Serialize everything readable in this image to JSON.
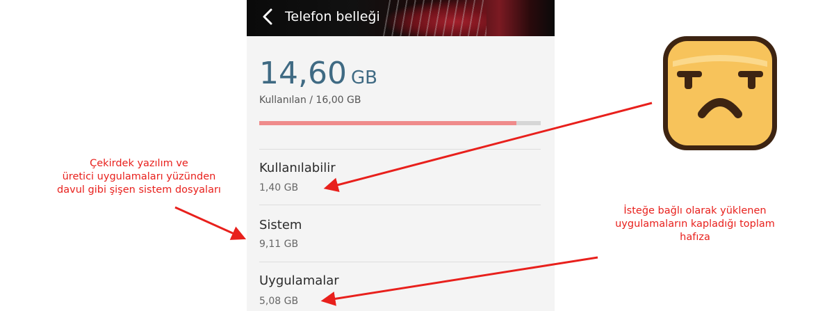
{
  "header": {
    "back_icon": "chevron-left-icon",
    "title": "Telefon belleği"
  },
  "storage": {
    "used_value": "14,60",
    "used_unit": "GB",
    "used_label": "Kullanılan / 16,00 GB",
    "used_fraction": 0.9125,
    "items": [
      {
        "title": "Kullanılabilir",
        "value": "1,40 GB"
      },
      {
        "title": "Sistem",
        "value": "9,11 GB"
      },
      {
        "title": "Uygulamalar",
        "value": "5,08 GB"
      }
    ]
  },
  "annotations": {
    "left": [
      "Çekirdek yazılım ve",
      "üretici uygulamaları yüzünden",
      "davul gibi şişen sistem dosyaları"
    ],
    "right": [
      "İsteğe bağlı olarak yüklenen",
      "uygulamaların kapladığı toplam",
      "hafıza"
    ]
  },
  "colors": {
    "annotation_red": "#e8201c",
    "bar_fill": "#ef8b8b",
    "used_value": "#3f6a83",
    "emoji_face": "#f7c35b"
  },
  "icons": {
    "emoji": "sad-face-emoji-icon"
  }
}
